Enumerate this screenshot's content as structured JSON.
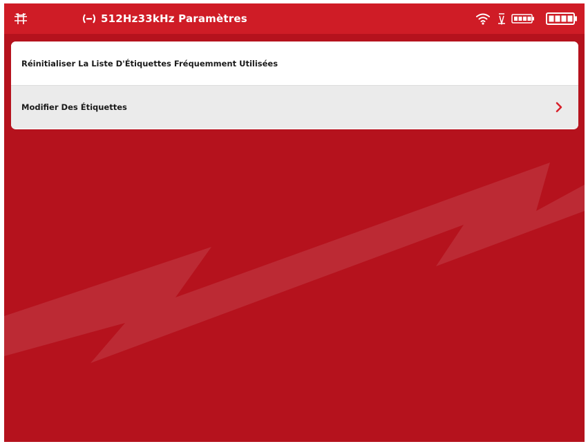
{
  "status_bar": {
    "left_icon": "grid-globe-icon",
    "title_icon": "frequency-range-icon",
    "title": "512Hz33kHz Paramètres",
    "wifi_icon": "wifi-icon",
    "signal_icon": "antenna-icon",
    "battery_small_icon": "battery-small-icon",
    "battery_main_icon": "battery-main-icon"
  },
  "menu": {
    "items": [
      {
        "label": "Réinitialiser La Liste D'Étiquettes Fréquemment Utilisées",
        "icon": null
      },
      {
        "label": "Modifier Des Étiquettes",
        "icon": "chevron-right-icon"
      }
    ]
  },
  "colors": {
    "background": "#b5121d",
    "status_bar": "#cf1c26",
    "accent": "#cf1c26",
    "panel": "#ffffff",
    "row_alt": "#ebebeb"
  }
}
